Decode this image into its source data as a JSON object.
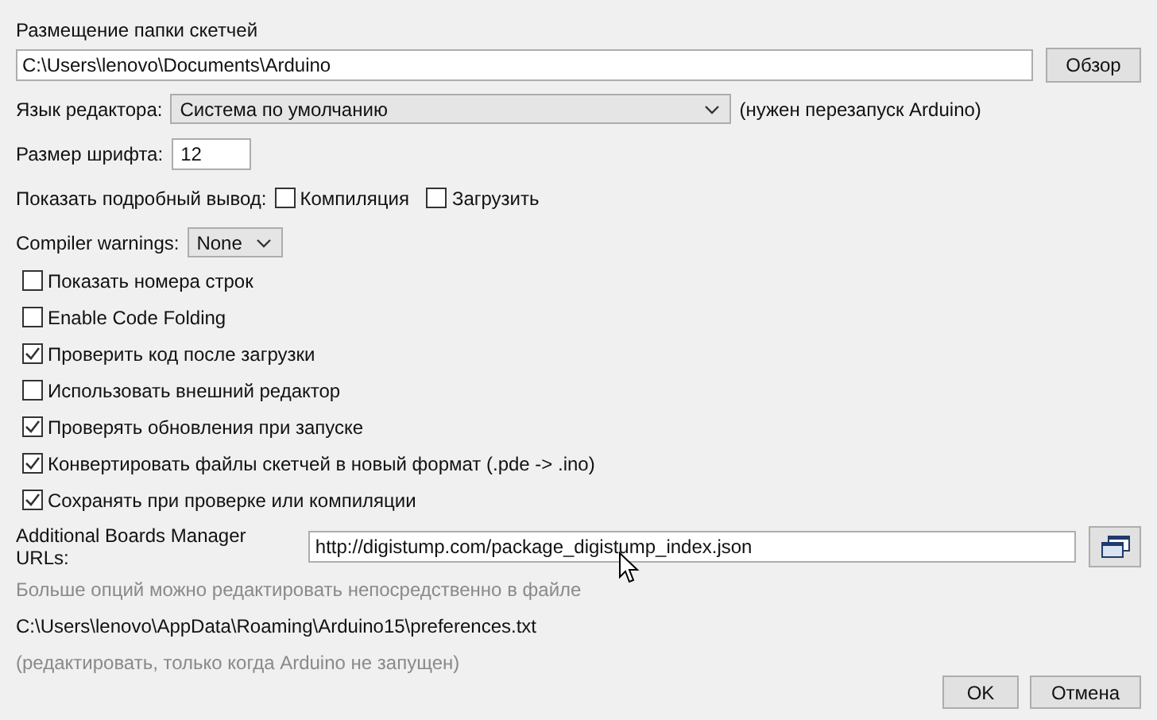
{
  "sketchbook": {
    "label": "Размещение папки скетчей",
    "path": "C:\\Users\\lenovo\\Documents\\Arduino",
    "browse_button": "Обзор"
  },
  "editor_language": {
    "label": "Язык редактора:",
    "value": "Система по умолчанию",
    "note": "(нужен перезапуск Arduino)"
  },
  "font_size": {
    "label": "Размер шрифта:",
    "value": "12"
  },
  "verbose_output": {
    "label": "Показать подробный вывод:",
    "options": [
      {
        "label": "Компиляция",
        "checked": false
      },
      {
        "label": "Загрузить",
        "checked": false
      }
    ]
  },
  "compiler_warnings": {
    "label": "Compiler warnings:",
    "value": "None"
  },
  "options": [
    {
      "label": "Показать номера строк",
      "checked": false
    },
    {
      "label": "Enable Code Folding",
      "checked": false
    },
    {
      "label": "Проверить код после загрузки",
      "checked": true
    },
    {
      "label": "Использовать внешний редактор",
      "checked": false
    },
    {
      "label": "Проверять обновления при запуске",
      "checked": true
    },
    {
      "label": "Конвертировать файлы скетчей в новый формат (.pde -> .ino)",
      "checked": true
    },
    {
      "label": "Сохранять при проверке или компиляции",
      "checked": true
    }
  ],
  "boards_urls": {
    "label": "Additional Boards Manager URLs:",
    "value": "http://digistump.com/package_digistump_index.json"
  },
  "info": [
    "Больше опций можно редактировать непосредственно в файле",
    "C:\\Users\\lenovo\\AppData\\Roaming\\Arduino15\\preferences.txt",
    "(редактировать, только когда Arduino не запущен)"
  ],
  "buttons": [
    "OK",
    "Отмена"
  ]
}
